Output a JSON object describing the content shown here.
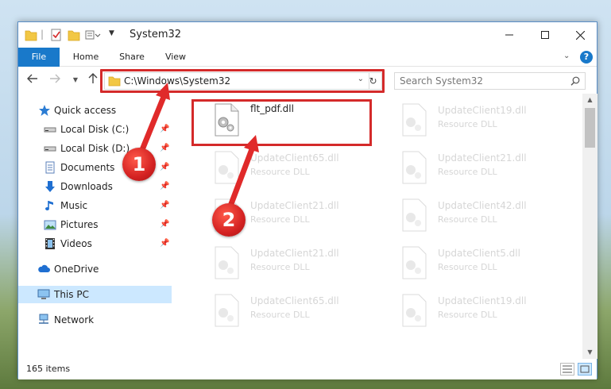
{
  "window": {
    "title": "System32"
  },
  "ribbon": {
    "tabs": [
      {
        "label": "File"
      },
      {
        "label": "Home"
      },
      {
        "label": "Share"
      },
      {
        "label": "View"
      }
    ]
  },
  "address": {
    "path": "C:\\Windows\\System32",
    "search_placeholder": "Search System32"
  },
  "nav": {
    "items": [
      {
        "label": "Quick access"
      },
      {
        "label": "Local Disk (C:)"
      },
      {
        "label": "Local Disk (D:)"
      },
      {
        "label": "Documents"
      },
      {
        "label": "Downloads"
      },
      {
        "label": "Music"
      },
      {
        "label": "Pictures"
      },
      {
        "label": "Videos"
      },
      {
        "label": "OneDrive"
      },
      {
        "label": "This PC"
      },
      {
        "label": "Network"
      }
    ]
  },
  "files": [
    {
      "name": "flt_pdf.dll",
      "type": ""
    },
    {
      "name": "UpdateClient19.dll",
      "type": "Resource DLL"
    },
    {
      "name": "UpdateClient65.dll",
      "type": "Resource DLL"
    },
    {
      "name": "UpdateClient21.dll",
      "type": "Resource DLL"
    },
    {
      "name": "UpdateClient21.dll",
      "type": "Resource DLL"
    },
    {
      "name": "UpdateClient42.dll",
      "type": "Resource DLL"
    },
    {
      "name": "UpdateClient21.dll",
      "type": "Resource DLL"
    },
    {
      "name": "UpdateClient5.dll",
      "type": "Resource DLL"
    },
    {
      "name": "UpdateClient65.dll",
      "type": "Resource DLL"
    },
    {
      "name": "UpdateClient19.dll",
      "type": "Resource DLL"
    }
  ],
  "status": {
    "item_count": "165 items"
  },
  "callouts": {
    "one": "1",
    "two": "2"
  },
  "colors": {
    "accent": "#1979ca",
    "highlight": "#d42a2a",
    "selection": "#cce8ff"
  }
}
